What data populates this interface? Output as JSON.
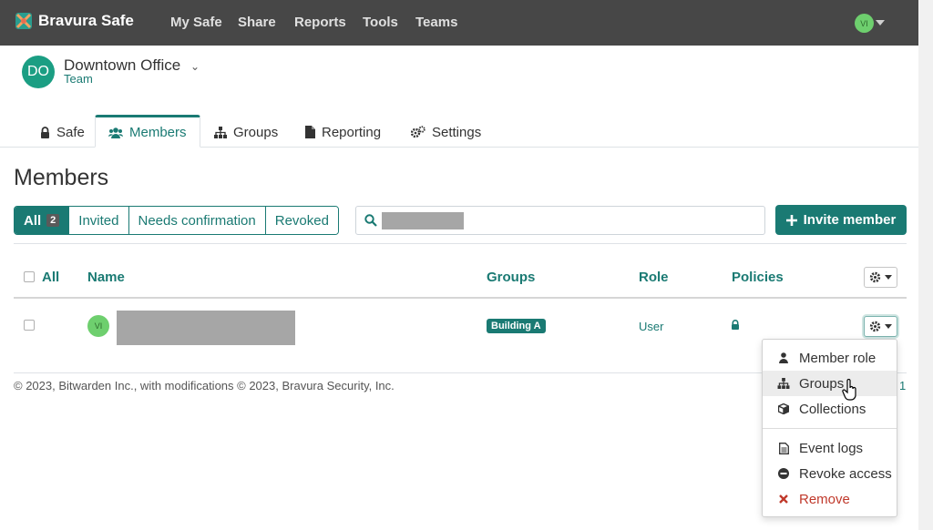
{
  "app": {
    "brand": "Bravura Safe"
  },
  "nav": {
    "items": [
      "My Safe",
      "Share",
      "Reports",
      "Tools",
      "Teams"
    ],
    "avatar_initials": "VI"
  },
  "org": {
    "initials": "DO",
    "name": "Downtown Office",
    "caret": "⌄",
    "subtitle": "Team"
  },
  "tabs": [
    {
      "label": "Safe",
      "icon": "lock-icon"
    },
    {
      "label": "Members",
      "icon": "users-icon",
      "active": true
    },
    {
      "label": "Groups",
      "icon": "sitemap-icon"
    },
    {
      "label": "Reporting",
      "icon": "file-icon"
    },
    {
      "label": "Settings",
      "icon": "cogs-icon"
    }
  ],
  "page": {
    "title": "Members"
  },
  "filters": {
    "all_label": "All",
    "all_count": "2",
    "invited": "Invited",
    "needs_confirmation": "Needs confirmation",
    "revoked": "Revoked"
  },
  "invite_button": {
    "label": "Invite member",
    "icon": "plus-icon"
  },
  "table": {
    "headers": {
      "select_all": "All",
      "name": "Name",
      "groups": "Groups",
      "role": "Role",
      "policies": "Policies"
    },
    "rows": [
      {
        "avatar_initials": "VI",
        "group": "Building A",
        "role": "User",
        "policy_icon": "lock-icon"
      }
    ]
  },
  "footer": {
    "text": "© 2023, Bitwarden Inc., with modifications © 2023, Bravura Security, Inc.",
    "partial": "1"
  },
  "dropdown": {
    "items": [
      {
        "label": "Member role",
        "icon": "user-icon"
      },
      {
        "label": "Groups",
        "icon": "sitemap-icon",
        "hover": true
      },
      {
        "label": "Collections",
        "icon": "cube-icon"
      },
      {
        "label": "Event logs",
        "icon": "file-text-icon"
      },
      {
        "label": "Revoke access",
        "icon": "minus-circle-icon"
      },
      {
        "label": "Remove",
        "icon": "times-icon",
        "danger": true
      }
    ]
  },
  "colors": {
    "accent": "#1a7a73",
    "navbar": "#474747",
    "danger": "#c0392b"
  }
}
